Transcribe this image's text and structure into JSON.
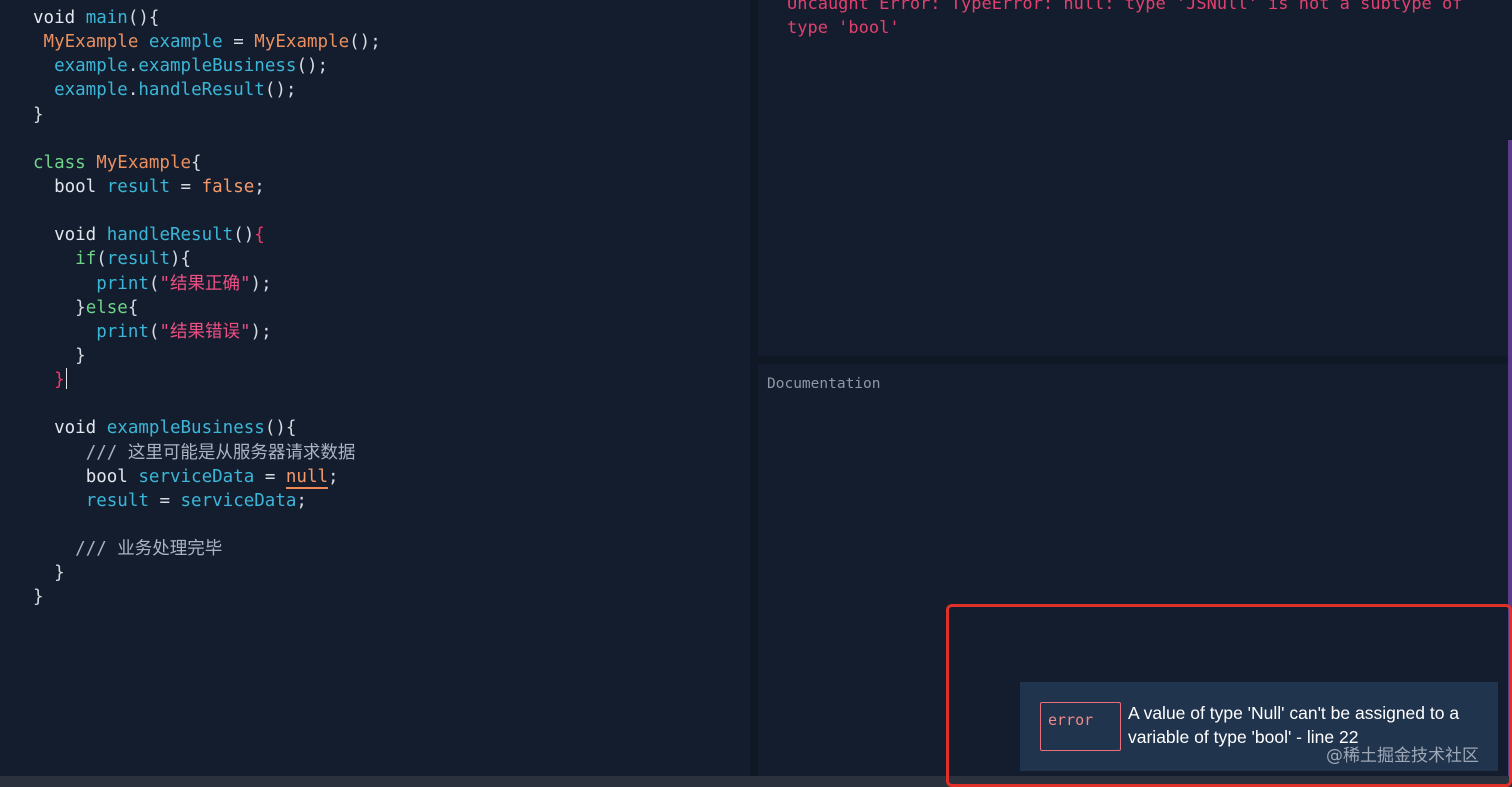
{
  "editor": {
    "lines": [
      [
        {
          "c": "kw",
          "t": "void "
        },
        {
          "c": "fn",
          "t": "main"
        },
        {
          "c": "pn",
          "t": "(){"
        }
      ],
      [
        {
          "c": "pn",
          "t": " "
        },
        {
          "c": "ty",
          "t": "MyExample"
        },
        {
          "c": "pn",
          "t": " "
        },
        {
          "c": "fn",
          "t": "example"
        },
        {
          "c": "pn",
          "t": " = "
        },
        {
          "c": "ty",
          "t": "MyExample"
        },
        {
          "c": "pn",
          "t": "();"
        }
      ],
      [
        {
          "c": "pn",
          "t": "  "
        },
        {
          "c": "fn",
          "t": "example"
        },
        {
          "c": "pn",
          "t": "."
        },
        {
          "c": "fn",
          "t": "exampleBusiness"
        },
        {
          "c": "pn",
          "t": "();"
        }
      ],
      [
        {
          "c": "pn",
          "t": "  "
        },
        {
          "c": "fn",
          "t": "example"
        },
        {
          "c": "pn",
          "t": "."
        },
        {
          "c": "fn",
          "t": "handleResult"
        },
        {
          "c": "pn",
          "t": "();"
        }
      ],
      [
        {
          "c": "pn",
          "t": "}"
        }
      ],
      [],
      [
        {
          "c": "kwg",
          "t": "class "
        },
        {
          "c": "ty",
          "t": "MyExample"
        },
        {
          "c": "pn",
          "t": "{"
        }
      ],
      [
        {
          "c": "pn",
          "t": "  "
        },
        {
          "c": "kw",
          "t": "bool "
        },
        {
          "c": "fn",
          "t": "result"
        },
        {
          "c": "pn",
          "t": " = "
        },
        {
          "c": "lit",
          "t": "false"
        },
        {
          "c": "pn",
          "t": ";"
        }
      ],
      [],
      [
        {
          "c": "pn",
          "t": "  "
        },
        {
          "c": "kw",
          "t": "void "
        },
        {
          "c": "fn",
          "t": "handleResult"
        },
        {
          "c": "pn",
          "t": "()"
        },
        {
          "c": "br",
          "t": "{"
        }
      ],
      [
        {
          "c": "pn",
          "t": "    "
        },
        {
          "c": "kwg",
          "t": "if"
        },
        {
          "c": "pn",
          "t": "("
        },
        {
          "c": "fn",
          "t": "result"
        },
        {
          "c": "pn",
          "t": "){"
        }
      ],
      [
        {
          "c": "pn",
          "t": "      "
        },
        {
          "c": "fn",
          "t": "print"
        },
        {
          "c": "pn",
          "t": "("
        },
        {
          "c": "str",
          "t": "\"结果正确\""
        },
        {
          "c": "pn",
          "t": ");"
        }
      ],
      [
        {
          "c": "pn",
          "t": "    }"
        },
        {
          "c": "kwg",
          "t": "else"
        },
        {
          "c": "pn",
          "t": "{"
        }
      ],
      [
        {
          "c": "pn",
          "t": "      "
        },
        {
          "c": "fn",
          "t": "print"
        },
        {
          "c": "pn",
          "t": "("
        },
        {
          "c": "str",
          "t": "\"结果错误\""
        },
        {
          "c": "pn",
          "t": ");"
        }
      ],
      [
        {
          "c": "pn",
          "t": "    }"
        }
      ],
      [
        {
          "c": "pn",
          "t": "  "
        },
        {
          "c": "br",
          "t": "}"
        },
        {
          "c": "caret",
          "t": ""
        }
      ],
      [],
      [
        {
          "c": "pn",
          "t": "  "
        },
        {
          "c": "kw",
          "t": "void "
        },
        {
          "c": "fn",
          "t": "exampleBusiness"
        },
        {
          "c": "pn",
          "t": "(){"
        }
      ],
      [
        {
          "c": "pn",
          "t": "     "
        },
        {
          "c": "cm",
          "t": "/// 这里可能是从服务器请求数据"
        }
      ],
      [
        {
          "c": "pn",
          "t": "     "
        },
        {
          "c": "kw",
          "t": "bool "
        },
        {
          "c": "fn",
          "t": "serviceData"
        },
        {
          "c": "pn",
          "t": " = "
        },
        {
          "c": "lit err",
          "t": "null"
        },
        {
          "c": "pn",
          "t": ";"
        }
      ],
      [
        {
          "c": "pn",
          "t": "     "
        },
        {
          "c": "fn",
          "t": "result"
        },
        {
          "c": "pn",
          "t": " = "
        },
        {
          "c": "fn",
          "t": "serviceData"
        },
        {
          "c": "pn",
          "t": ";"
        }
      ],
      [],
      [
        {
          "c": "pn",
          "t": "    "
        },
        {
          "c": "cm",
          "t": "/// 业务处理完毕"
        }
      ],
      [
        {
          "c": "pn",
          "t": "  }"
        }
      ],
      [
        {
          "c": "pn",
          "t": "}"
        }
      ]
    ]
  },
  "console": {
    "error_text": "Uncaught Error: TypeError: null: type 'JSNull' is not a subtype of type 'bool'"
  },
  "docs": {
    "label": "Documentation"
  },
  "issue": {
    "severity": "error",
    "message": "A value of type 'Null' can't be assigned to a variable of type 'bool' - line 22"
  },
  "watermark": "@稀土掘金技术社区",
  "colors": {
    "background": "#131d2d",
    "error_text": "#e2406f",
    "highlight_box": "#e0302a",
    "toast_bg": "#21344d"
  }
}
